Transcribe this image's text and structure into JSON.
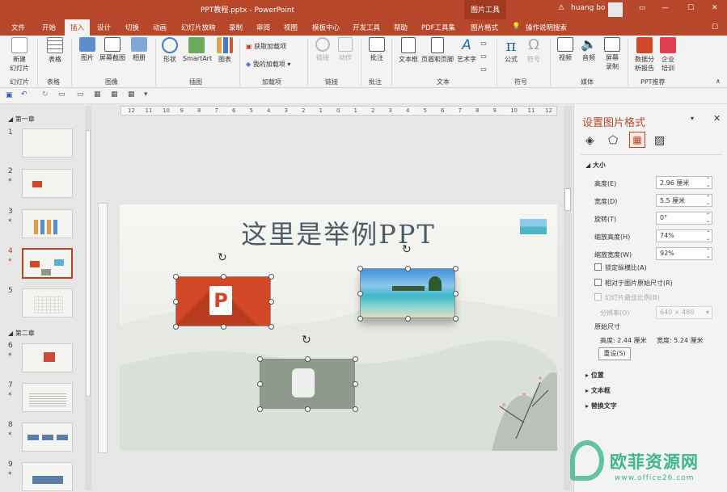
{
  "window": {
    "title": "PPT教程.pptx  -  PowerPoint",
    "context_tab": "图片工具",
    "user": "huang bo"
  },
  "tabs": [
    "文件",
    "开始",
    "插入",
    "设计",
    "切换",
    "动画",
    "幻灯片放映",
    "录制",
    "审阅",
    "视图",
    "模板中心",
    "开发工具",
    "帮助",
    "PDF工具集",
    "图片格式"
  ],
  "selected_tab": "插入",
  "tell_me": "操作说明搜索",
  "ribbon": {
    "buttons": [
      "新建\n幻灯片",
      "表格",
      "图片",
      "屏幕截图",
      "相册",
      "形状",
      "SmartArt",
      "图表",
      "获取加载项",
      "我的加载项",
      "链接",
      "动作",
      "批注",
      "文本框",
      "页眉和页脚",
      "艺术字",
      "公式",
      "符号",
      "视频",
      "音频",
      "屏幕\n录制",
      "数据分\n析报告",
      "企业\n培训"
    ],
    "groups": [
      "幻灯片",
      "表格",
      "图像",
      "插图",
      "加载项",
      "链接",
      "批注",
      "文本",
      "符号",
      "媒体",
      "PPT推荐"
    ]
  },
  "ruler": {
    "h_ticks": [
      "12",
      "11",
      "10",
      "9",
      "8",
      "7",
      "6",
      "5",
      "4",
      "3",
      "2",
      "1",
      "0",
      "1",
      "2",
      "3",
      "4",
      "5",
      "6",
      "7",
      "8",
      "9",
      "10",
      "11",
      "12"
    ]
  },
  "sidebar": {
    "sections": [
      "第一章",
      "第二章"
    ],
    "slide_numbers": [
      "1",
      "2",
      "3",
      "4",
      "5",
      "6",
      "7",
      "8",
      "9"
    ],
    "selected_slide": "4"
  },
  "slide": {
    "title": "这里是举例PPT"
  },
  "format_pane": {
    "title": "设置图片格式",
    "section_size": "大小",
    "fields": [
      {
        "label": "高度(E)",
        "value": "2.96 厘米"
      },
      {
        "label": "宽度(D)",
        "value": "5.5 厘米"
      },
      {
        "label": "旋转(T)",
        "value": "0°"
      },
      {
        "label": "缩放高度(H)",
        "value": "74%"
      },
      {
        "label": "缩放宽度(W)",
        "value": "92%"
      }
    ],
    "checkboxes": [
      "锁定纵横比(A)",
      "相对于图片原始尺寸(R)",
      "幻灯片最佳比例(B)"
    ],
    "resolution_label": "分辨率(O)",
    "resolution_value": "640 × 480",
    "original_size_label": "原始尺寸",
    "original_height": "高度: 2.44 厘米",
    "original_width": "宽度: 5.24 厘米",
    "reset_button": "重设(S)",
    "collapsed_sections": [
      "位置",
      "文本框",
      "替换文字"
    ]
  },
  "watermark": {
    "text": "欧菲资源网",
    "url": "www.office26.com"
  },
  "colors": {
    "accent": "#b7472a",
    "ppt_red": "#d24726",
    "gray_icon": "#8e9a8c"
  }
}
